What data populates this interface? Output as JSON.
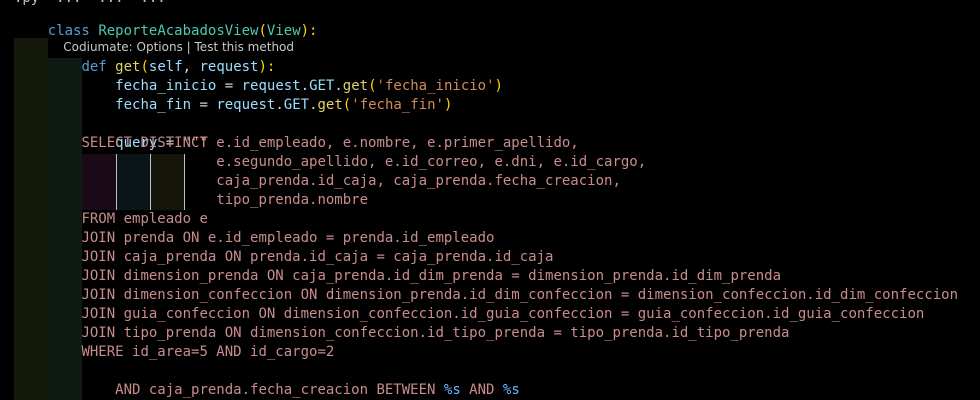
{
  "editor": {
    "cutoff_line": ".py  ...  ...  ...",
    "class_line": {
      "keyword": "class",
      "name": "ReporteAcabadosView",
      "open": "(",
      "base": "View",
      "close": "):"
    },
    "codelens": {
      "options": "Codiumate: Options",
      "separator": " | ",
      "test": "Test this method"
    },
    "def_line": {
      "keyword": "def",
      "name": "get",
      "open": "(",
      "self": "self",
      "comma": ", ",
      "request": "request",
      "close": "):"
    },
    "assign1": {
      "var": "fecha_inicio",
      "op": " = ",
      "obj": "request",
      "dot1": ".",
      "attr": "GET",
      "dot2": ".",
      "method": "get",
      "open": "(",
      "arg": "'fecha_inicio'",
      "close": ")"
    },
    "assign2": {
      "var": "fecha_fin",
      "op": " = ",
      "obj": "request",
      "dot1": ".",
      "attr": "GET",
      "dot2": ".",
      "method": "get",
      "open": "(",
      "arg": "'fecha_fin'",
      "close": ")"
    },
    "query_line": {
      "var": "query",
      "op": " = ",
      "quote": "\"\"\""
    },
    "sql_lines": [
      "SELECT DISTINCT e.id_empleado, e.nombre, e.primer_apellido,",
      "                e.segundo_apellido, e.id_correo, e.dni, e.id_cargo,",
      "                caja_prenda.id_caja, caja_prenda.fecha_creacion,",
      "                tipo_prenda.nombre",
      "FROM empleado e",
      "JOIN prenda ON e.id_empleado = prenda.id_empleado",
      "JOIN caja_prenda ON prenda.id_caja = caja_prenda.id_caja",
      "JOIN dimension_prenda ON caja_prenda.id_dim_prenda = dimension_prenda.id_dim_prenda",
      "JOIN dimension_confeccion ON dimension_prenda.id_dim_confeccion = dimension_confeccion.id_dim_confeccion",
      "JOIN guia_confeccion ON dimension_confeccion.id_guia_confeccion = guia_confeccion.id_guia_confeccion",
      "JOIN tipo_prenda ON dimension_confeccion.id_tipo_prenda = tipo_prenda.id_tipo_prenda",
      "WHERE id_area=5 AND id_cargo=2"
    ],
    "between_line": {
      "text": "AND caja_prenda.fecha_creacion BETWEEN ",
      "p1": "%s",
      "mid": " AND ",
      "p2": "%s"
    },
    "closing_quote": "\"\"\"",
    "colors": {
      "background": "#000000",
      "keyword": "#569cd6",
      "class_name": "#4ec9b0",
      "function": "#e3d36a",
      "parameter": "#9cdcfe",
      "string": "#d28a5a",
      "sql_text": "#d6a4a4",
      "format_placeholder": "#6cb6ff",
      "indent_guide_1": "#141a08",
      "indent_guide_2": "#1a1a08",
      "indent_guide_3": "#0c1818",
      "indent_guide_4": "#1a0a18"
    }
  }
}
